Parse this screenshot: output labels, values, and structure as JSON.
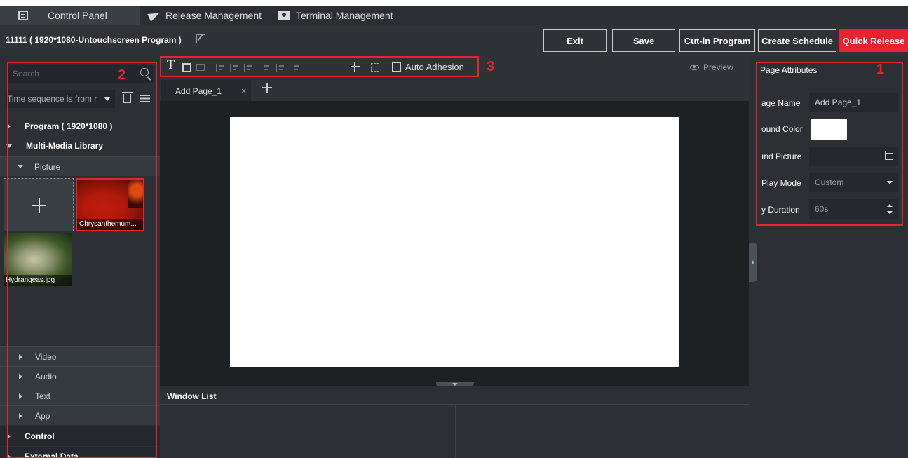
{
  "tabs": [
    {
      "label": "Control Panel",
      "icon": "panel-icon",
      "active": true
    },
    {
      "label": "Release Management",
      "icon": "paper-plane-icon",
      "active": false
    },
    {
      "label": "Terminal Management",
      "icon": "terminal-icon",
      "active": false
    }
  ],
  "header": {
    "program_title": "11111 ( 1920*1080-Untouchscreen Program )",
    "buttons": {
      "exit": "Exit",
      "save": "Save",
      "cut_in": "Cut-in Program",
      "create_schedule": "Create Schedule",
      "quick_release": "Quick Release"
    },
    "accent_color": "#e8222f"
  },
  "left_panel": {
    "search_placeholder": "Search",
    "time_sequence": "Time sequence is from r",
    "tree": {
      "program": "Program ( 1920*1080 )",
      "library": "Multi-Media Library",
      "picture": "Picture",
      "video": "Video",
      "audio": "Audio",
      "text": "Text",
      "app": "App",
      "control": "Control",
      "external": "External Data"
    },
    "thumbnails": [
      {
        "name": "Chrysanthemum..."
      },
      {
        "name": "Hydrangeas.jpg"
      }
    ]
  },
  "toolbar": {
    "auto_adhesion": "Auto Adhesion",
    "preview": "Preview"
  },
  "page_tabs": [
    {
      "label": "Add Page_1",
      "close": "×"
    }
  ],
  "window_list": {
    "title": "Window List"
  },
  "attributes": {
    "title": "Page Attributes",
    "page_name_label": "age Name",
    "page_name_value": "Add Page_1",
    "bg_color_label": "ound Color",
    "bg_color_value": "#ffffff",
    "bg_picture_label": "ınd Picture",
    "play_mode_label": "Play Mode",
    "play_mode_value": "Custom",
    "play_duration_label": "y Duration",
    "play_duration_value": "60s"
  },
  "annotations": [
    "1",
    "2",
    "3"
  ]
}
